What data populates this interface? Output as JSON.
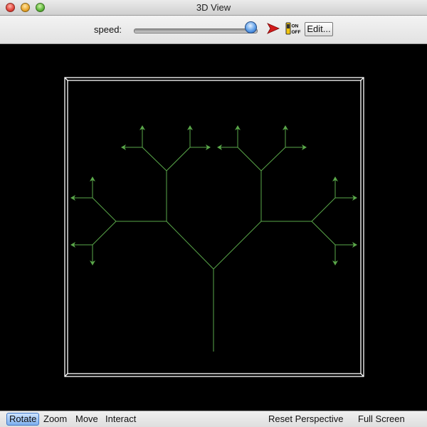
{
  "window": {
    "title": "3D View"
  },
  "toolbar": {
    "speed_label": "speed:",
    "speed_value": 1.0,
    "edit_label": "Edit...",
    "play_icon": "play-arrow-icon",
    "onoff_icon": "on-off-switch-icon",
    "onoff_text_on": "ON",
    "onoff_text_off": "OFF"
  },
  "viewport": {
    "background": "#000000",
    "frame_color": "#ffffff",
    "tree_color": "#5aa84a"
  },
  "statusbar": {
    "modes": [
      {
        "label": "Rotate",
        "selected": true
      },
      {
        "label": "Zoom",
        "selected": false
      },
      {
        "label": "Move",
        "selected": false
      },
      {
        "label": "Interact",
        "selected": false
      }
    ],
    "reset_label": "Reset Perspective",
    "fullscreen_label": "Full Screen"
  }
}
